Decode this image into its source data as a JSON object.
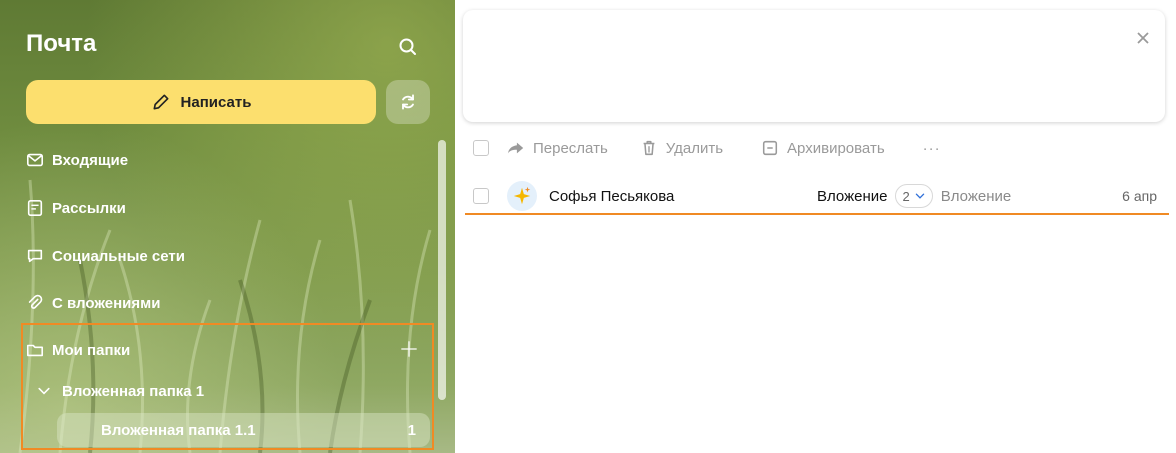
{
  "sidebar": {
    "title": "Почта",
    "search_icon": "search-icon",
    "compose_label": "Написать",
    "compose_icon": "pencil-icon",
    "compose_color": "#fcdf6e",
    "refresh_icon": "refresh-icon",
    "items": [
      {
        "label": "Входящие",
        "icon": "inbox-icon"
      },
      {
        "label": "Рассылки",
        "icon": "newsletter-icon"
      },
      {
        "label": "Социальные сети",
        "icon": "chat-icon"
      },
      {
        "label": "С вложениями",
        "icon": "paperclip-icon"
      }
    ],
    "folders": {
      "label": "Мои папки",
      "icon": "folder-icon",
      "add_icon": "plus-icon",
      "highlight_color": "#f08a24",
      "subfolder": {
        "label": "Вложенная папка 1",
        "icon": "chevron-down-icon",
        "child": {
          "label": "Вложенная папка 1.1",
          "count": "1"
        }
      }
    }
  },
  "notice": {
    "close_icon": "close-icon"
  },
  "toolbar": {
    "forward_label": "Переслать",
    "delete_label": "Удалить",
    "archive_label": "Архивировать",
    "more_label": "···"
  },
  "messages": [
    {
      "sender": "Софья Песьякова",
      "avatar_icon": "sparkle-icon",
      "subject": "Вложение",
      "thread_count": "2",
      "snippet": "Вложение",
      "date": "6 апр"
    }
  ],
  "accent_color": "#f08a24"
}
